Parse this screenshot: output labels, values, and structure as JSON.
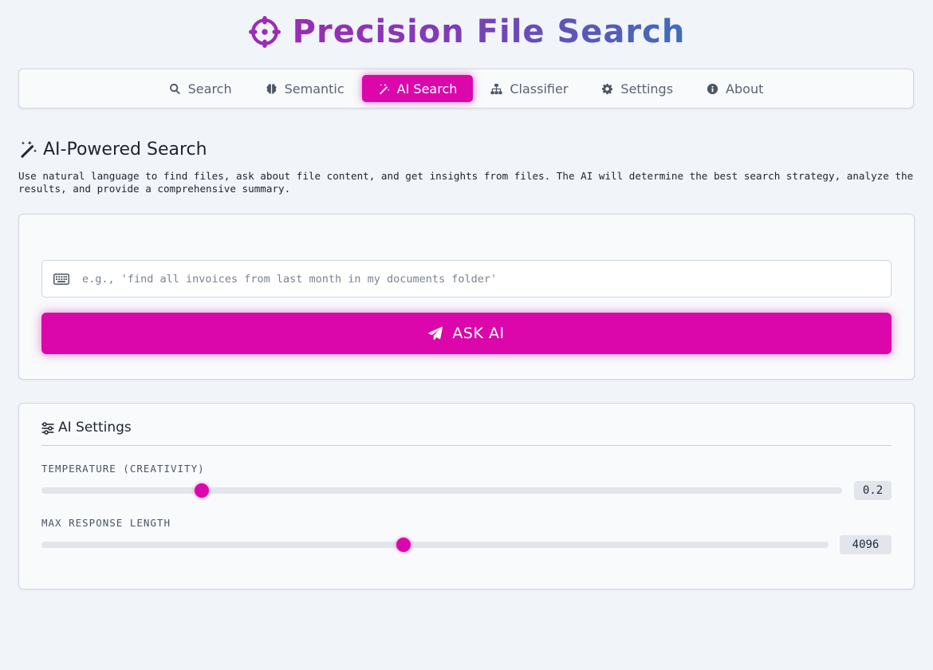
{
  "app": {
    "title": "Precision File Search",
    "logo_icon": "crosshair-icon",
    "title_gradient": [
      "#9c2bb5",
      "#7b3fb6",
      "#3f6dba"
    ]
  },
  "nav": {
    "tabs": [
      {
        "id": "search",
        "label": "Search",
        "icon": "search-icon",
        "active": false
      },
      {
        "id": "semantic",
        "label": "Semantic",
        "icon": "brain-icon",
        "active": false
      },
      {
        "id": "ai-search",
        "label": "AI Search",
        "icon": "magic-wand-icon",
        "active": true
      },
      {
        "id": "classifier",
        "label": "Classifier",
        "icon": "sitemap-icon",
        "active": false
      },
      {
        "id": "settings",
        "label": "Settings",
        "icon": "gear-icon",
        "active": false
      },
      {
        "id": "about",
        "label": "About",
        "icon": "info-icon",
        "active": false
      }
    ]
  },
  "ai_search": {
    "title": "AI-Powered Search",
    "title_icon": "magic-wand-icon",
    "description": "Use natural language to find files, ask about file content, and get insights from files. The AI will determine the best search strategy, analyze the results, and provide a comprehensive summary.",
    "query": {
      "icon": "keyboard-icon",
      "value": "",
      "placeholder": "e.g., 'find all invoices from last month in my documents folder'"
    },
    "ask_button": {
      "label": "ASK AI",
      "icon": "paper-plane-icon"
    }
  },
  "ai_settings": {
    "title": "AI Settings",
    "icon": "sliders-icon",
    "temperature": {
      "label": "Temperature (Creativity)",
      "value": 0.2,
      "display": "0.2",
      "min": 0,
      "max": 1
    },
    "max_length": {
      "label": "Max Response Length",
      "value": 4096,
      "display": "4096",
      "min": 0,
      "max": 8900
    }
  },
  "colors": {
    "accent": "#db07ab",
    "background": "#f1f4f9",
    "card": "#f8fafc",
    "border": "#d3d8e0",
    "text": "#1e2430",
    "muted": "#5a6371"
  }
}
